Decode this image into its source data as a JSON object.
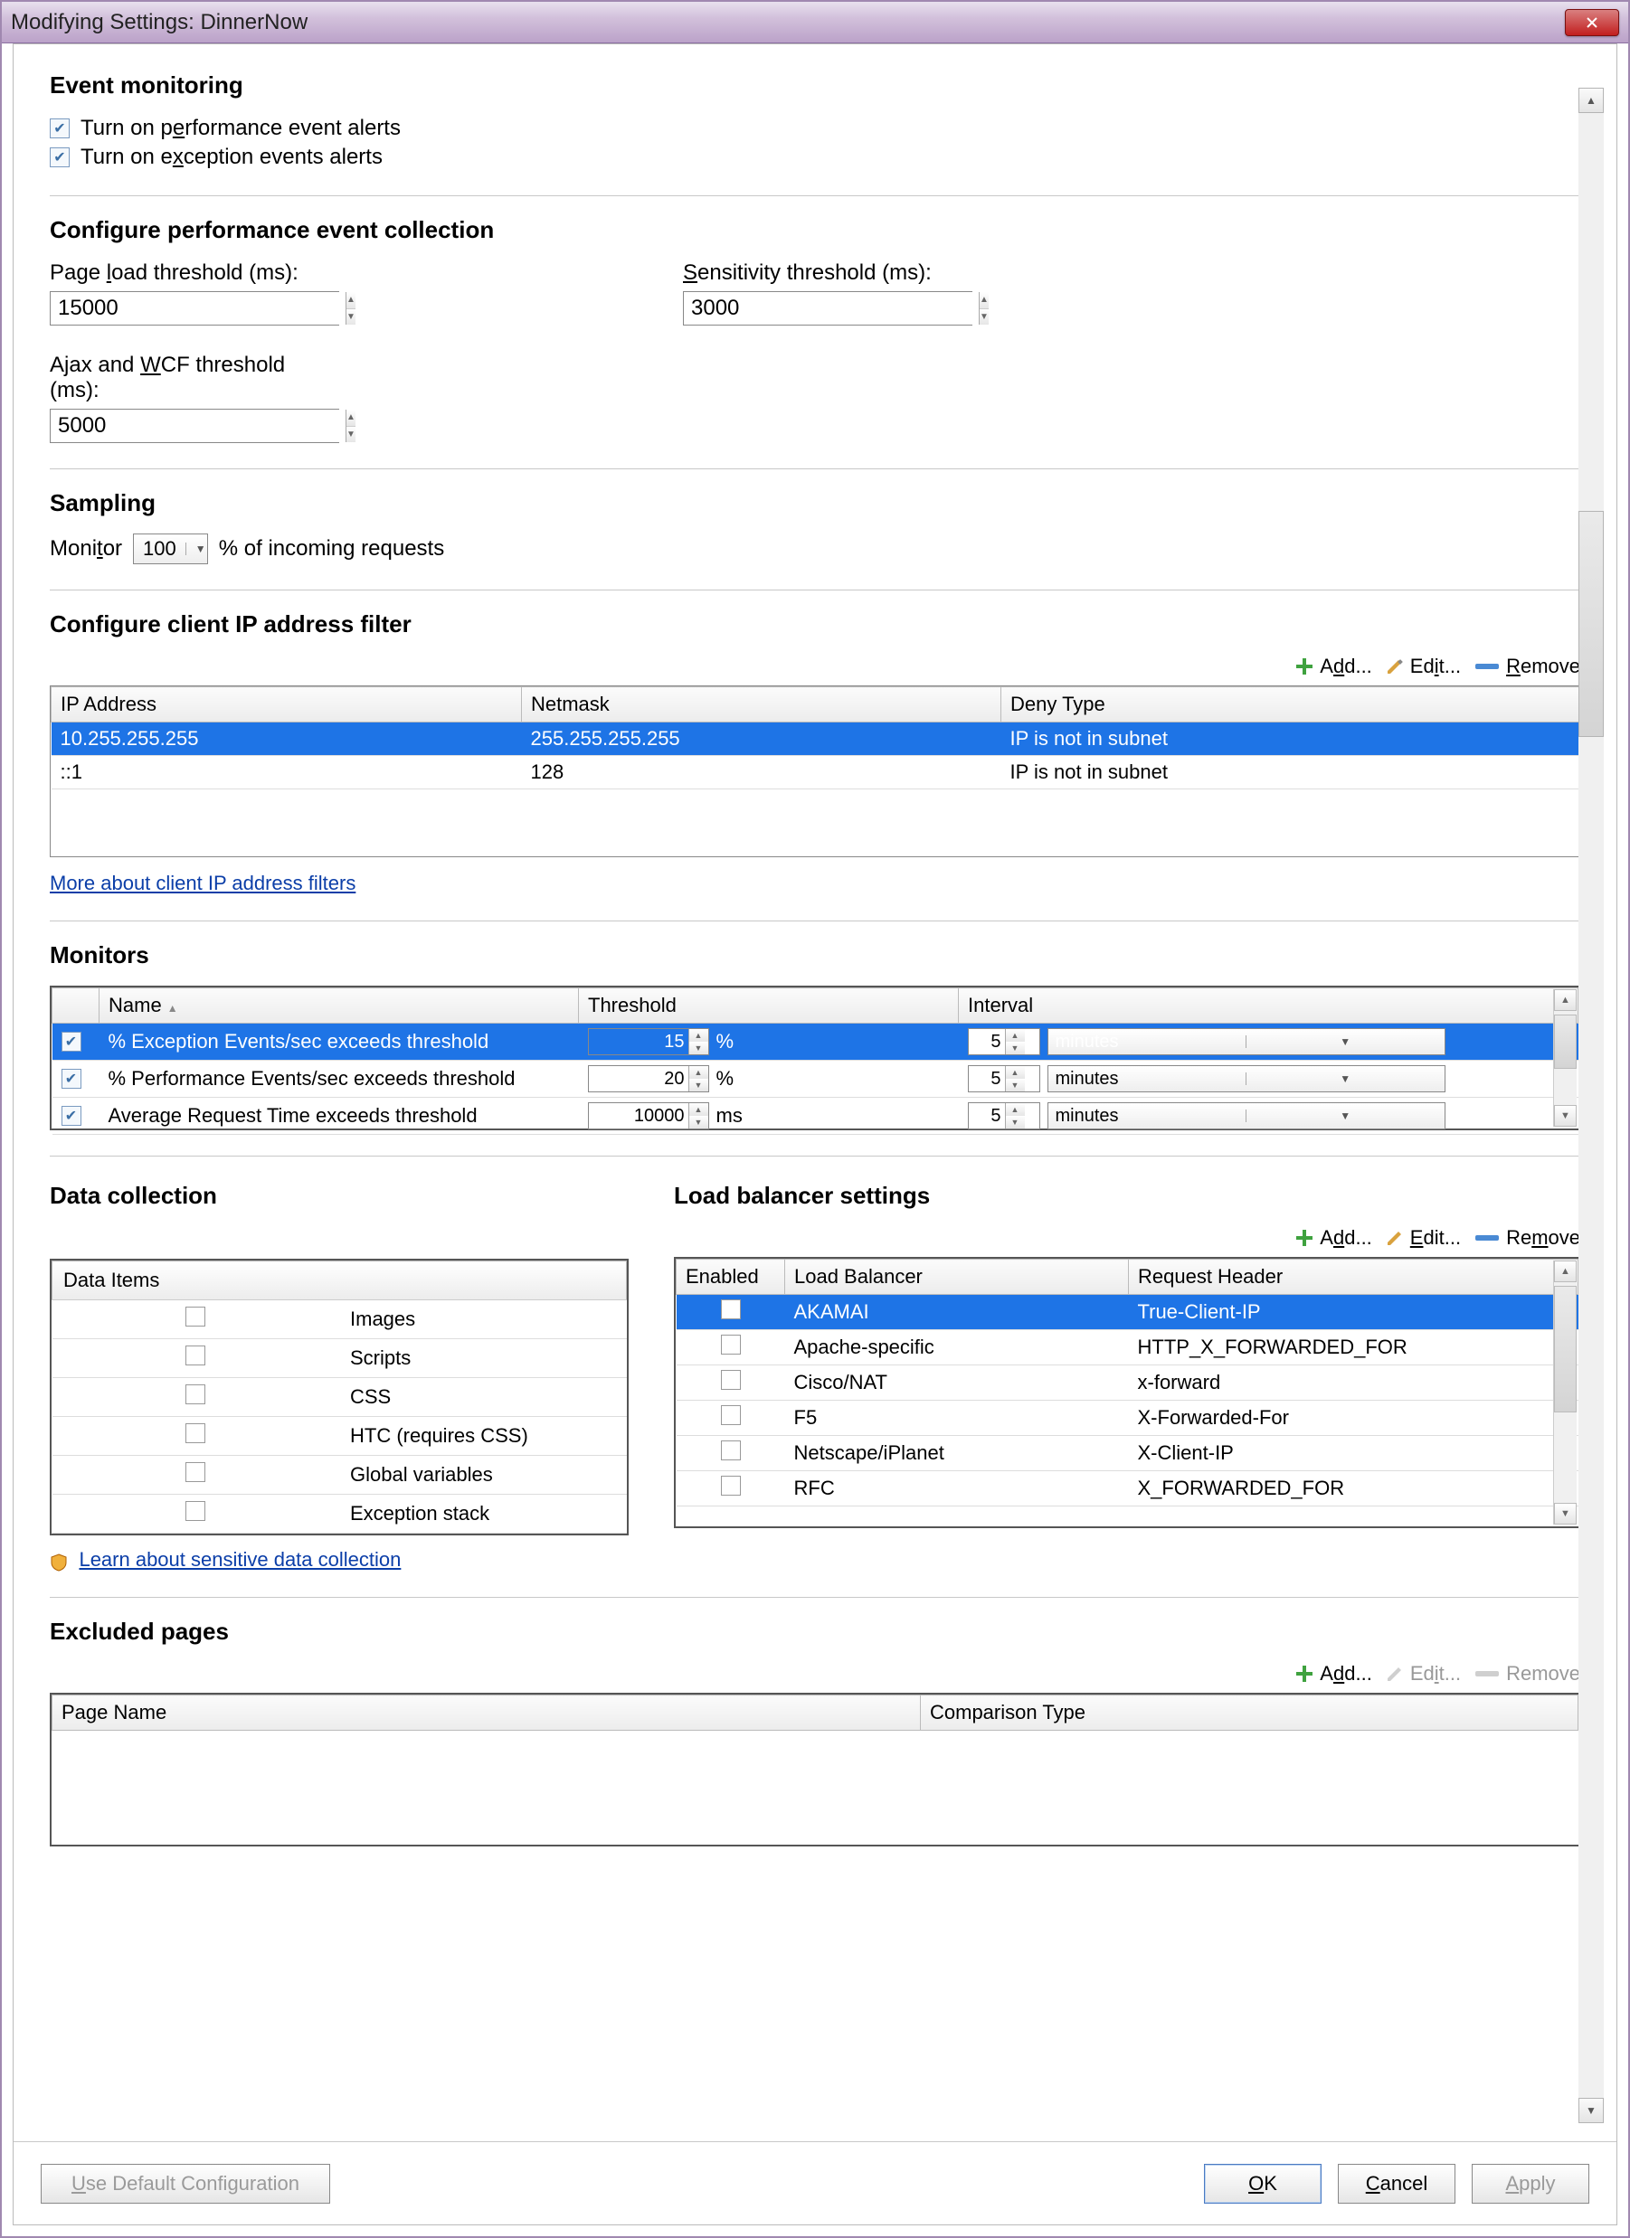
{
  "window": {
    "title": "Modifying Settings: DinnerNow"
  },
  "event_monitoring": {
    "heading": "Event monitoring",
    "perf_label": "Turn on p<u>e</u>rformance event alerts",
    "exc_label": "Turn on e<u>x</u>ception events alerts",
    "perf_checked": true,
    "exc_checked": true
  },
  "perf_collection": {
    "heading": "Configure performance event collection",
    "page_load_label": "Page <u>l</u>oad threshold (ms):",
    "page_load_value": "15000",
    "sens_label": "<u>S</u>ensitivity threshold (ms):",
    "sens_value": "3000",
    "ajax_label": "Ajax and <u>W</u>CF threshold (ms):",
    "ajax_value": "5000"
  },
  "sampling": {
    "heading": "Sampling",
    "monitor_label": "Moni<u>t</u>or",
    "percent": "100",
    "suffix": "% of incoming requests"
  },
  "ipfilter": {
    "heading": "Configure client IP address filter",
    "add": "A<u>d</u>d...",
    "edit": "Ed<u>i</u>t...",
    "remove": "<u>R</u>emove",
    "cols": {
      "ip": "IP Address",
      "mask": "Netmask",
      "deny": "Deny Type"
    },
    "rows": [
      {
        "ip": "10.255.255.255",
        "mask": "255.255.255.255",
        "deny": "IP is not in subnet",
        "selected": true
      },
      {
        "ip": "::1",
        "mask": "128",
        "deny": "IP is not in subnet",
        "selected": false
      }
    ],
    "help": "More about client IP address filters"
  },
  "monitors": {
    "heading": "Monitors",
    "cols": {
      "name": "Name",
      "threshold": "Threshold",
      "interval": "Interval"
    },
    "rows": [
      {
        "checked": true,
        "name": "% Exception Events/sec exceeds threshold",
        "threshold": "15",
        "tunit": "%",
        "interval": "5",
        "iunit": "minutes",
        "selected": true
      },
      {
        "checked": true,
        "name": "% Performance Events/sec exceeds threshold",
        "threshold": "20",
        "tunit": "%",
        "interval": "5",
        "iunit": "minutes",
        "selected": false
      },
      {
        "checked": true,
        "name": "Average Request Time exceeds threshold",
        "threshold": "10000",
        "tunit": "ms",
        "interval": "5",
        "iunit": "minutes",
        "selected": false
      }
    ]
  },
  "data_collection": {
    "heading": "Data collection",
    "col": "Data Items",
    "items": [
      {
        "label": "Images",
        "checked": false
      },
      {
        "label": "Scripts",
        "checked": false
      },
      {
        "label": "CSS",
        "checked": false
      },
      {
        "label": "HTC (requires CSS)",
        "checked": false
      },
      {
        "label": "Global variables",
        "checked": false
      },
      {
        "label": "Exception stack",
        "checked": false
      }
    ],
    "learn": "Learn about sensitive data collection"
  },
  "load_balancer": {
    "heading": "Load balancer settings",
    "add": "A<u>d</u>d...",
    "edit": "<u>E</u>dit...",
    "remove": "Re<u>m</u>ove",
    "cols": {
      "enabled": "Enabled",
      "lb": "Load Balancer",
      "header": "Request Header"
    },
    "rows": [
      {
        "checked": false,
        "lb": "AKAMAI",
        "header": "True-Client-IP",
        "selected": true
      },
      {
        "checked": false,
        "lb": "Apache-specific",
        "header": "HTTP_X_FORWARDED_FOR",
        "selected": false
      },
      {
        "checked": false,
        "lb": "Cisco/NAT",
        "header": "x-forward",
        "selected": false
      },
      {
        "checked": false,
        "lb": "F5",
        "header": "X-Forwarded-For",
        "selected": false
      },
      {
        "checked": false,
        "lb": "Netscape/iPlanet",
        "header": "X-Client-IP",
        "selected": false
      },
      {
        "checked": false,
        "lb": "RFC",
        "header": "X_FORWARDED_FOR",
        "selected": false
      }
    ]
  },
  "excluded": {
    "heading": "Excluded pages",
    "add": "A<u>d</u>d...",
    "edit": "Ed<u>i</u>t...",
    "remove": "Remove",
    "cols": {
      "page": "Page Name",
      "cmp": "Comparison Type"
    }
  },
  "footer": {
    "defaults": "<u>U</u>se Default Configuration",
    "ok": "<u>O</u>K",
    "cancel": "<u>C</u>ancel",
    "apply": "<u>A</u>pply"
  }
}
